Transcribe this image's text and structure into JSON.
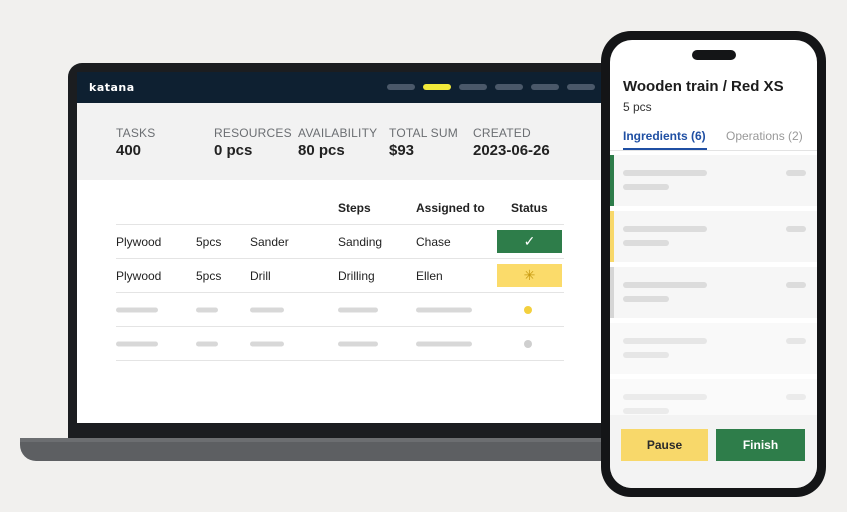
{
  "laptop": {
    "logo": "katana",
    "summary": [
      {
        "label": "TASKS",
        "value": "400"
      },
      {
        "label": "RESOURCES",
        "value": "0 pcs"
      },
      {
        "label": "AVAILABILITY",
        "value": "80 pcs"
      },
      {
        "label": "TOTAL SUM",
        "value": "$93"
      },
      {
        "label": "CREATED",
        "value": "2023-06-26"
      }
    ],
    "table": {
      "headers": {
        "steps": "Steps",
        "assigned": "Assigned to",
        "status": "Status"
      },
      "rows": [
        {
          "material": "Plywood",
          "qty": "5pcs",
          "tool": "Sander",
          "step": "Sanding",
          "assignee": "Chase",
          "status": "done"
        },
        {
          "material": "Plywood",
          "qty": "5pcs",
          "tool": "Drill",
          "step": "Drilling",
          "assignee": "Ellen",
          "status": "in-progress"
        }
      ],
      "status_icons": {
        "done": "✓",
        "in-progress": "✳"
      }
    },
    "colors": {
      "done": "#2e7d4a",
      "progress": "#fbdb6a",
      "pending_dot": "#f3d03e",
      "idle_dot": "#cfcfcf",
      "nav_active": "#f2ea3a"
    }
  },
  "phone": {
    "title": "Wooden train / Red XS",
    "subtitle": "5 pcs",
    "tabs": {
      "active": "Ingredients (6)",
      "inactive": "Operations (2)"
    },
    "buttons": {
      "pause": "Pause",
      "finish": "Finish"
    },
    "card_accents": [
      "#2e7d4a",
      "#f8d86a",
      "#d6d6d6",
      "",
      ""
    ]
  }
}
